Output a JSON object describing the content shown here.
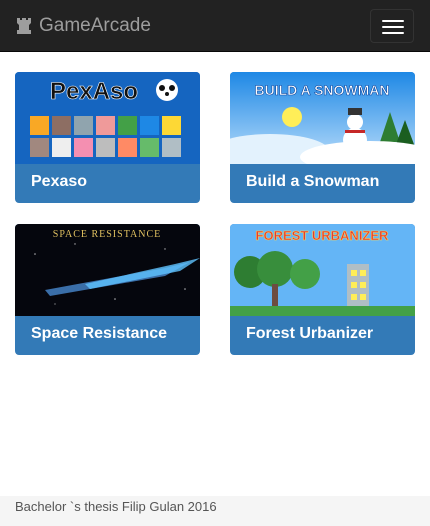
{
  "navbar": {
    "brand": "GameArcade",
    "brand_icon": "rook-icon",
    "menu_icon": "hamburger-menu-icon"
  },
  "games": [
    {
      "title": "Pexaso",
      "banner": "PexAso"
    },
    {
      "title": "Build a Snowman",
      "banner": "BUILD A SNOWMAN"
    },
    {
      "title": "Space Resistance",
      "banner": "SPACE RESISTANCE"
    },
    {
      "title": "Forest Urbanizer",
      "banner": "FOREST URBANIZER"
    }
  ],
  "footer": {
    "text": "Bachelor `s thesis Filip Gulan 2016"
  },
  "colors": {
    "navbar": "#222222",
    "card": "#337ab7",
    "footer": "#f5f5f5"
  }
}
